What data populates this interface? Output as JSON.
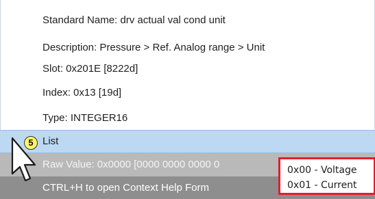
{
  "details": {
    "standard_name": "Standard Name: drv actual val cond unit",
    "description": "Description: Pressure > Ref. Analog range > Unit",
    "slot": "Slot: 0x201E [8222d]",
    "index": "Index: 0x13 [19d]",
    "type": "Type: INTEGER16"
  },
  "selected_row": {
    "label": "List"
  },
  "annotation": {
    "step_number": "5"
  },
  "raw_value": {
    "label": "Raw Value: 0x0000 [0000 0000 0000 0"
  },
  "help": {
    "label": "CTRL+H to open Context Help Form"
  },
  "list_options": [
    "0x00 - Voltage",
    "0x01 - Current"
  ],
  "icons": {
    "cursor": "mouse-pointer-icon"
  },
  "colors": {
    "selection": "#bcd8f3",
    "raw_value_bg": "#b9b9b9",
    "help_bg": "#8e8e8e",
    "callout_border": "#e31d2b",
    "step_badge": "#fff46a"
  }
}
